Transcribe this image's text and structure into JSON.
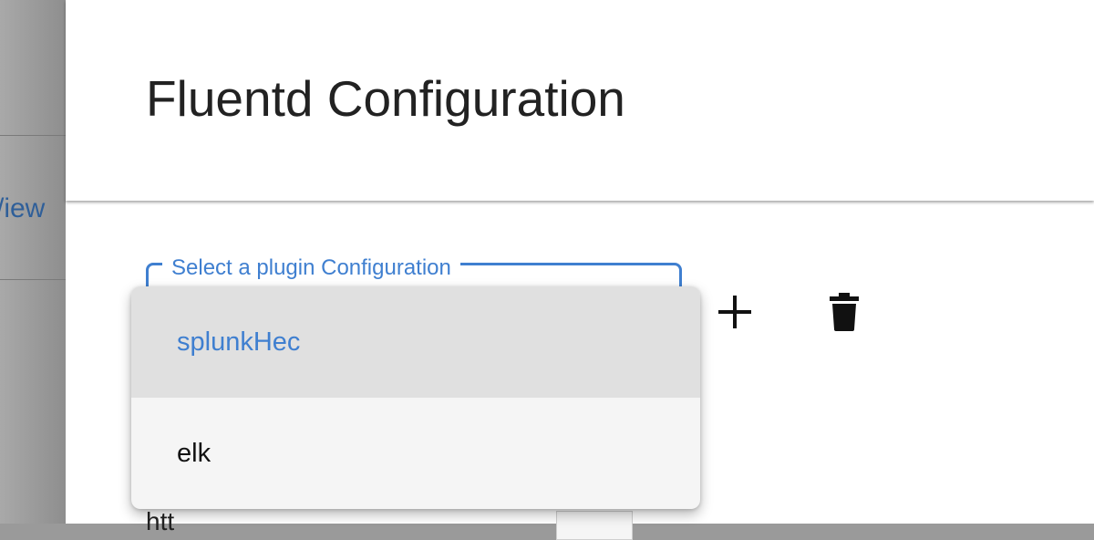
{
  "background": {
    "partial_link_text": "/iew"
  },
  "dialog": {
    "title": "Fluentd Configuration",
    "plugin_select": {
      "label": "Select a plugin Configuration",
      "options": [
        {
          "label": "splunkHec",
          "selected": true
        },
        {
          "label": "elk",
          "selected": false
        }
      ]
    },
    "actions": {
      "add_icon": "plus-icon",
      "delete_icon": "trash-icon"
    },
    "partial_field_text": "htt"
  },
  "colors": {
    "accent": "#3f7fd0",
    "title_text": "#222222",
    "menu_bg": "#f5f5f5",
    "selected_bg": "#e0e0e0"
  }
}
